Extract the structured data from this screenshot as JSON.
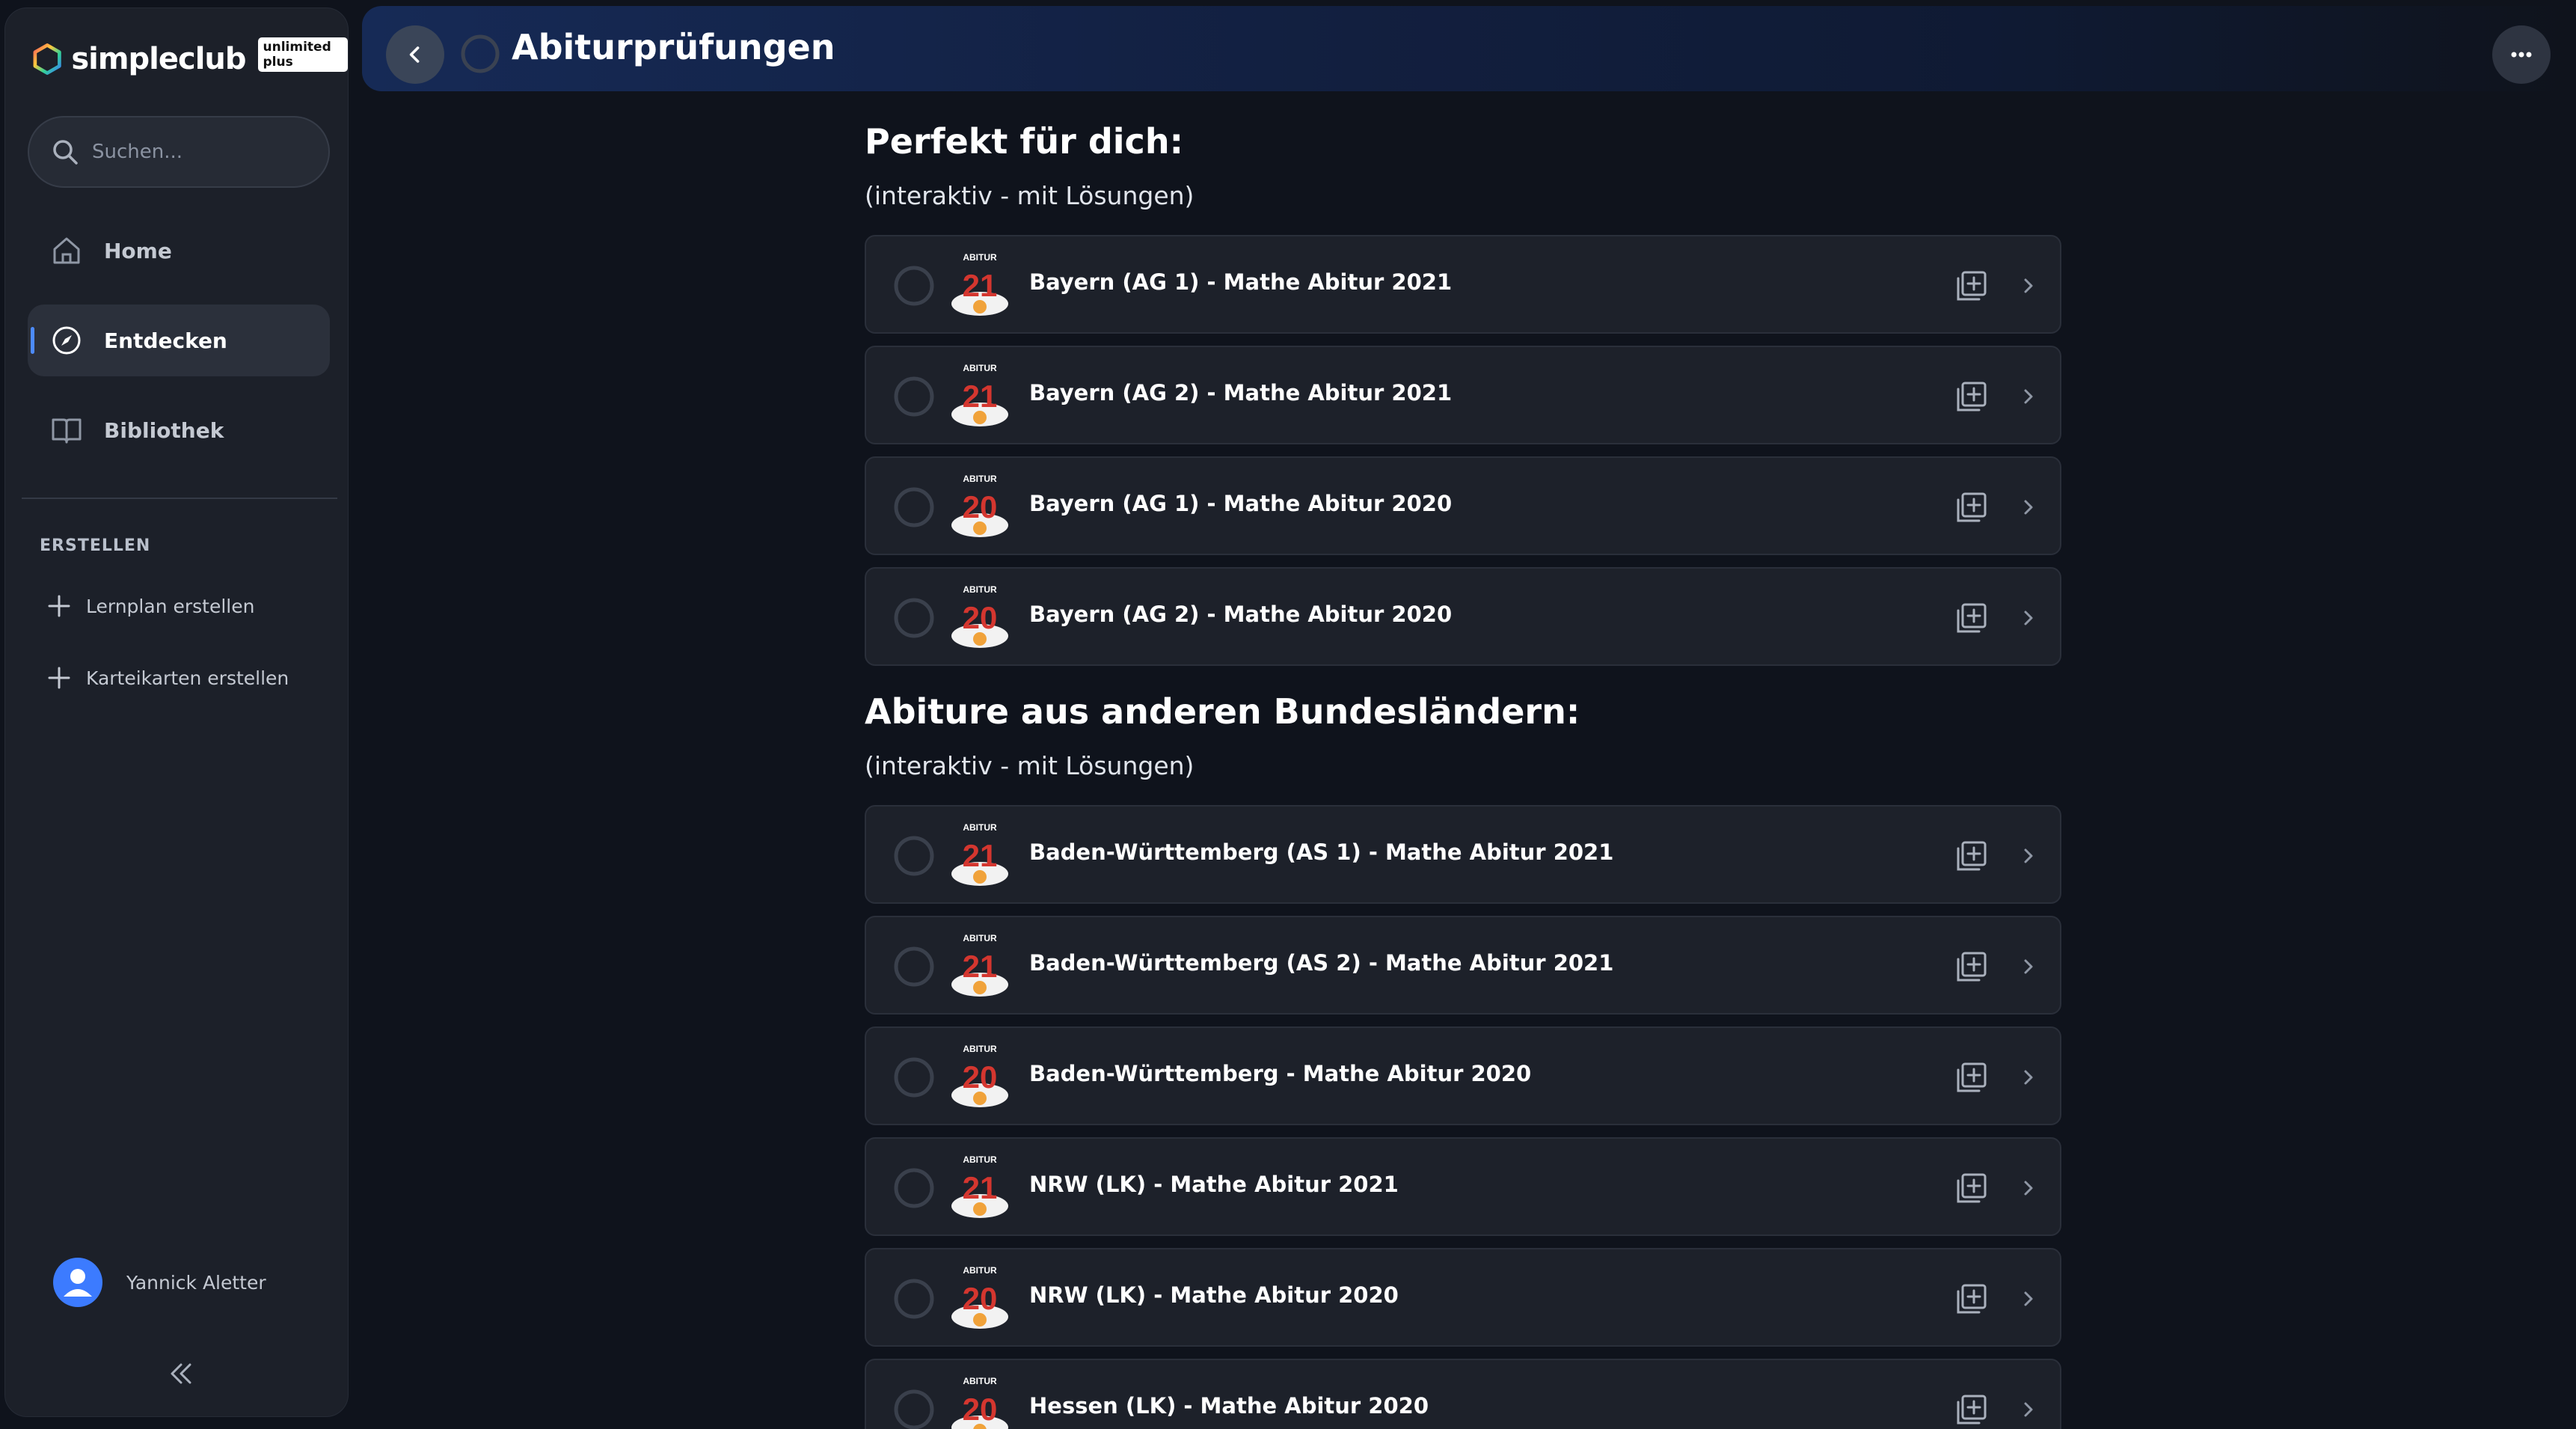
{
  "sidebar": {
    "brand": "simpleclub",
    "plan_badge": "unlimited plus",
    "search_placeholder": "Suchen...",
    "nav": [
      {
        "label": "Home",
        "icon": "home-icon",
        "active": false
      },
      {
        "label": "Entdecken",
        "icon": "compass-icon",
        "active": true
      },
      {
        "label": "Bibliothek",
        "icon": "book-icon",
        "active": false
      }
    ],
    "create_section_label": "ERSTELLEN",
    "create_items": [
      {
        "label": "Lernplan erstellen",
        "icon": "plus-icon"
      },
      {
        "label": "Karteikarten erstellen",
        "icon": "plus-icon"
      }
    ],
    "user_name": "Yannick Aletter",
    "collapse_icon": "double-chevron-left-icon"
  },
  "header": {
    "title": "Abiturprüfungen",
    "back_icon": "chevron-left-icon",
    "more_icon": "more-horizontal-icon"
  },
  "sections": [
    {
      "title": "Perfekt für dich:",
      "subtitle": "(interaktiv - mit Lösungen)",
      "items": [
        {
          "title": "Bayern (AG 1) - Mathe Abitur 2021",
          "badge_label": "ABITUR",
          "year": "21"
        },
        {
          "title": "Bayern (AG 2) - Mathe Abitur 2021",
          "badge_label": "ABITUR",
          "year": "21"
        },
        {
          "title": "Bayern (AG 1) - Mathe Abitur 2020",
          "badge_label": "ABITUR",
          "year": "20"
        },
        {
          "title": "Bayern (AG 2) - Mathe Abitur 2020",
          "badge_label": "ABITUR",
          "year": "20"
        }
      ]
    },
    {
      "title": "Abiture aus anderen Bundesländern:",
      "subtitle": "(interaktiv - mit Lösungen)",
      "items": [
        {
          "title": "Baden-Württemberg (AS 1) - Mathe Abitur 2021",
          "badge_label": "ABITUR",
          "year": "21"
        },
        {
          "title": "Baden-Württemberg (AS 2) - Mathe Abitur 2021",
          "badge_label": "ABITUR",
          "year": "21"
        },
        {
          "title": "Baden-Württemberg - Mathe Abitur 2020",
          "badge_label": "ABITUR",
          "year": "20"
        },
        {
          "title": "NRW (LK) - Mathe Abitur 2021",
          "badge_label": "ABITUR",
          "year": "21"
        },
        {
          "title": "NRW (LK) - Mathe Abitur 2020",
          "badge_label": "ABITUR",
          "year": "20"
        },
        {
          "title": "Hessen (LK) - Mathe Abitur 2020",
          "badge_label": "ABITUR",
          "year": "20"
        }
      ]
    }
  ],
  "colors": {
    "background": "#0f131c",
    "sidebar": "#1c2029",
    "card": "#1d212a",
    "accent": "#4d8bff",
    "badge_red": "#d4362f"
  }
}
